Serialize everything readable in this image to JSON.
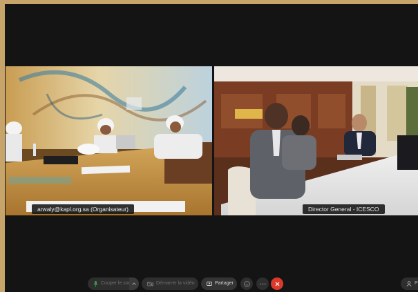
{
  "tiles": [
    {
      "name_label": "arwaly@kapl.org.sa (Organisateur)"
    },
    {
      "name_label": "Director General - ICESCO"
    }
  ],
  "toolbar": {
    "mic_label": "Couper le son",
    "camera_label": "Démarrer la vidéo",
    "share_label": "Partager",
    "participants_label": "Pa"
  },
  "colors": {
    "outer_frame": "#c7a46a",
    "background": "#141414",
    "leave_button": "#d93a2b"
  }
}
